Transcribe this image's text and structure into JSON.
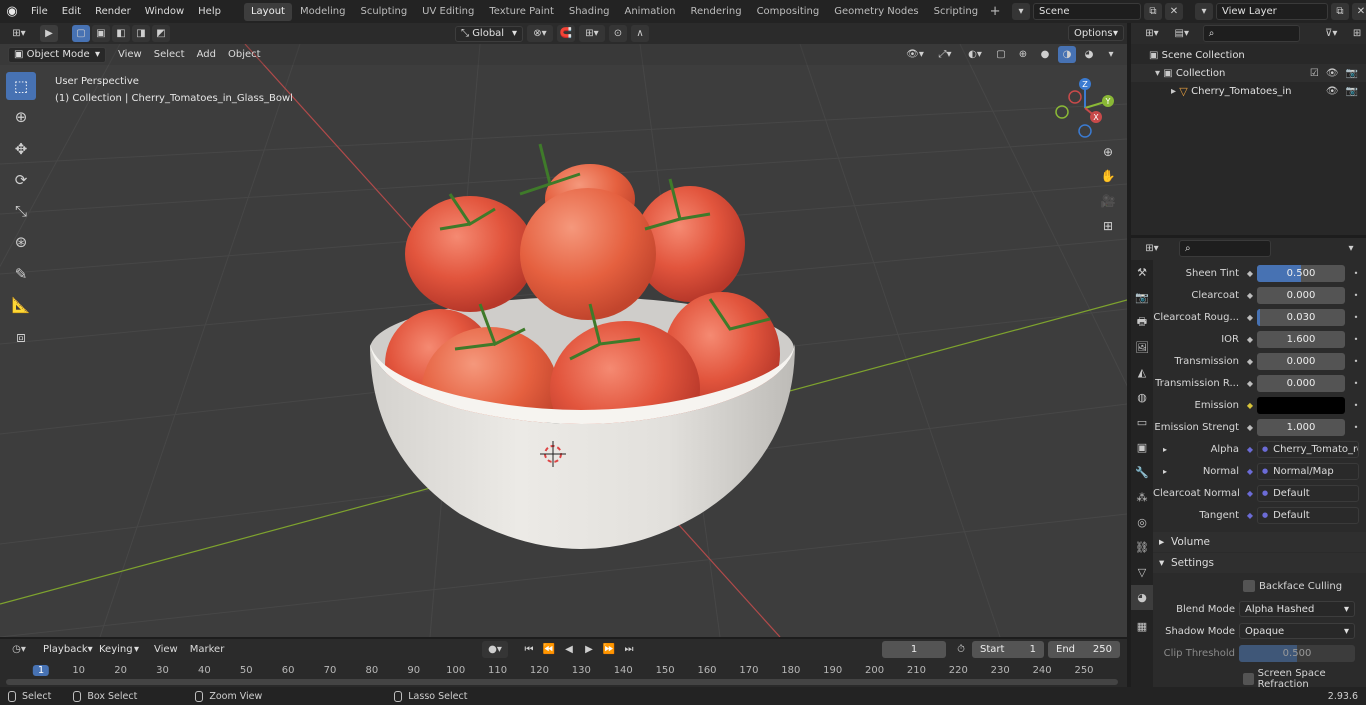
{
  "topbar": {
    "menus": [
      "File",
      "Edit",
      "Render",
      "Window",
      "Help"
    ],
    "workspaces": [
      "Layout",
      "Modeling",
      "Sculpting",
      "UV Editing",
      "Texture Paint",
      "Shading",
      "Animation",
      "Rendering",
      "Compositing",
      "Geometry Nodes",
      "Scripting"
    ],
    "active_workspace": "Layout",
    "scene": "Scene",
    "view_layer": "View Layer"
  },
  "viewport_header": {
    "mode": "Object Mode",
    "menus": [
      "View",
      "Select",
      "Add",
      "Object"
    ],
    "orientation": "Global",
    "options": "Options"
  },
  "viewport": {
    "perspective": "User Perspective",
    "collection_info": "(1) Collection | Cherry_Tomatoes_in_Glass_Bowl",
    "gizmo_axes": [
      "Z",
      "Y",
      "X"
    ]
  },
  "outliner": {
    "root": "Scene Collection",
    "collection": "Collection",
    "object": "Cherry_Tomatoes_in_Gla"
  },
  "properties": {
    "rows": [
      {
        "label": "Sheen Tint",
        "value": "0.500",
        "type": "slider",
        "fill": 0.5
      },
      {
        "label": "Clearcoat",
        "value": "0.000",
        "type": "slider",
        "fill": 0
      },
      {
        "label": "Clearcoat Roug...",
        "value": "0.030",
        "type": "slider",
        "fill": 0.03
      },
      {
        "label": "IOR",
        "value": "1.600",
        "type": "number"
      },
      {
        "label": "Transmission",
        "value": "0.000",
        "type": "slider",
        "fill": 0
      },
      {
        "label": "Transmission R...",
        "value": "0.000",
        "type": "slider",
        "fill": 0
      },
      {
        "label": "Emission",
        "value": "",
        "type": "color",
        "color": "#000000"
      },
      {
        "label": "Emission Strengt",
        "value": "1.000",
        "type": "number"
      },
      {
        "label": "Alpha",
        "value": "Cherry_Tomato_refr...",
        "type": "link",
        "expand": true
      },
      {
        "label": "Normal",
        "value": "Normal/Map",
        "type": "link",
        "expand": true
      },
      {
        "label": "Clearcoat Normal",
        "value": "Default",
        "type": "link"
      },
      {
        "label": "Tangent",
        "value": "Default",
        "type": "link"
      }
    ],
    "sections": {
      "volume": "Volume",
      "settings": "Settings"
    },
    "backface_culling": "Backface Culling",
    "blend_mode_label": "Blend Mode",
    "blend_mode": "Alpha Hashed",
    "shadow_mode_label": "Shadow Mode",
    "shadow_mode": "Opaque",
    "clip_threshold_label": "Clip Threshold",
    "clip_threshold": "0.500",
    "screen_space_refraction": "Screen Space Refraction"
  },
  "timeline": {
    "menus": [
      "Playback",
      "Keying",
      "View",
      "Marker"
    ],
    "current_frame": "1",
    "start_label": "Start",
    "start": "1",
    "end_label": "End",
    "end": "250",
    "ticks": [
      "1",
      "10",
      "20",
      "30",
      "40",
      "50",
      "60",
      "70",
      "80",
      "90",
      "100",
      "110",
      "120",
      "130",
      "140",
      "150",
      "160",
      "170",
      "180",
      "190",
      "200",
      "210",
      "220",
      "230",
      "240",
      "250"
    ]
  },
  "statusbar": {
    "select": "Select",
    "box_select": "Box Select",
    "zoom_view": "Zoom View",
    "lasso_select": "Lasso Select",
    "version": "2.93.6"
  },
  "colors": {
    "accent": "#4772b3",
    "x_axis": "#c84a4a",
    "y_axis": "#8ab836",
    "tomato": "#e2553d",
    "bowl": "#e8e6e2"
  }
}
